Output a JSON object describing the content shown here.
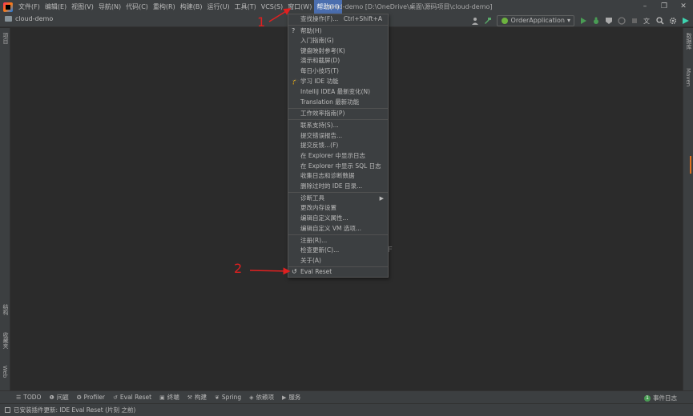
{
  "menubar": {
    "items": [
      "文件(F)",
      "编辑(E)",
      "视图(V)",
      "导航(N)",
      "代码(C)",
      "重构(R)",
      "构建(B)",
      "运行(U)",
      "工具(T)",
      "VCS(S)",
      "窗口(W)",
      "帮助(H)"
    ],
    "window_title": "cloud-demo [D:\\OneDrive\\桌面\\源码项目\\cloud-demo]",
    "win_minimize": "–",
    "win_restore": "❐",
    "win_close": "✕"
  },
  "toolbar": {
    "project_name": "cloud-demo",
    "run_config": "OrderApplication"
  },
  "left_strip": {
    "project_label": "项目",
    "structure_label": "结构",
    "favorites_label": "收藏夹",
    "web_label": "Web"
  },
  "right_strip": {
    "database_label": "数据库",
    "maven_label": "Maven"
  },
  "editor": {
    "hint_text": "F"
  },
  "help_menu": {
    "find_action": "查找操作(F)...",
    "find_action_shortcut": "Ctrl+Shift+A",
    "help": "帮助(H)",
    "getting_started": "入门指南(G)",
    "keymap_reference": "键盘映射参考(K)",
    "demos": "演示和截屏(D)",
    "tips": "每日小技巧(T)",
    "learn_ide": "学习 IDE 功能",
    "whats_new": "IntelliJ IDEA 最新变化(N)",
    "translation_new": "Translation 最新功能",
    "productivity": "工作效率指南(P)",
    "contact_support": "联系支持(S)...",
    "submit_bug": "提交错误报告...",
    "submit_feedback": "提交反馈...(F)",
    "explorer_log": "在 Explorer 中显示日志",
    "explorer_sql_log": "在 Explorer 中显示 SQL 日志",
    "collect_logs": "收集日志和诊断数据",
    "delete_old_ide": "删除过时的 IDE 目录...",
    "diagnostic_tools": "诊断工具",
    "change_memory": "更改内存设置",
    "edit_custom_props": "编辑自定义属性...",
    "edit_custom_vm": "编辑自定义 VM 选项...",
    "register": "注册(R)...",
    "check_updates": "检查更新(C)...",
    "about": "关于(A)",
    "eval_reset": "Eval Reset"
  },
  "annotations": {
    "one": "1",
    "two": "2"
  },
  "bottom_tabs": {
    "todo": "TODO",
    "problems": "问题",
    "profiler": "Profiler",
    "eval_reset": "Eval Reset",
    "terminal": "终端",
    "build": "构建",
    "spring": "Spring",
    "dependencies": "依赖项",
    "services": "服务",
    "event_log": "事件日志",
    "event_count": "1"
  },
  "statusbar": {
    "message": "已安装插件更新: IDE Eval Reset (片刻 之前)"
  },
  "colors": {
    "accent": "#4b6eaf",
    "annotation_red": "#e02020",
    "run_green": "#499c54"
  }
}
